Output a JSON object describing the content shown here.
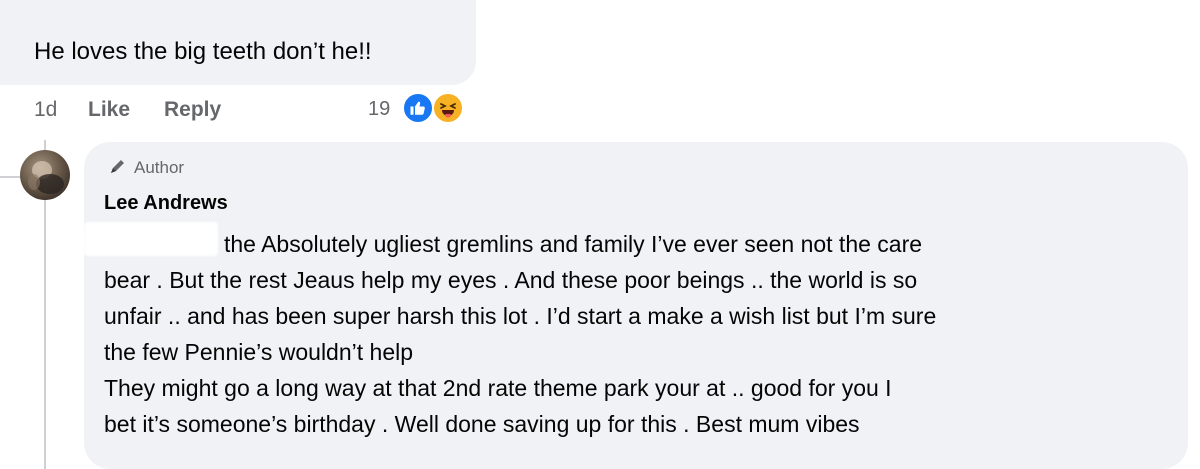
{
  "comment1": {
    "text": "He loves the big teeth don’t he!!",
    "time": "1d",
    "like_label": "Like",
    "reply_label": "Reply",
    "reaction_count": "19",
    "reactions": [
      "like-icon",
      "haha-icon"
    ]
  },
  "reply": {
    "badge_icon": "pencil-author-icon",
    "badge_label": "Author",
    "author_name": "Lee Andrews",
    "lines": [
      "the Absolutely ugliest gremlins and family I’ve ever seen not the care",
      "bear . But the rest Jeaus help my eyes . And these poor beings .. the world is so",
      "unfair .. and has been super harsh this lot . I’d start a make a wish list but I’m sure",
      "the few Pennie’s wouldn’t help",
      "They might go a long way at that 2nd rate theme park your at .. good for you I",
      "bet it’s someone’s birthday . Well done saving up for this . Best mum vibes"
    ]
  },
  "colors": {
    "bubble": "#f0f2f5",
    "secondary_text": "#65676b",
    "like_blue": "#1877f2",
    "haha_yellow": "#f7b125"
  }
}
